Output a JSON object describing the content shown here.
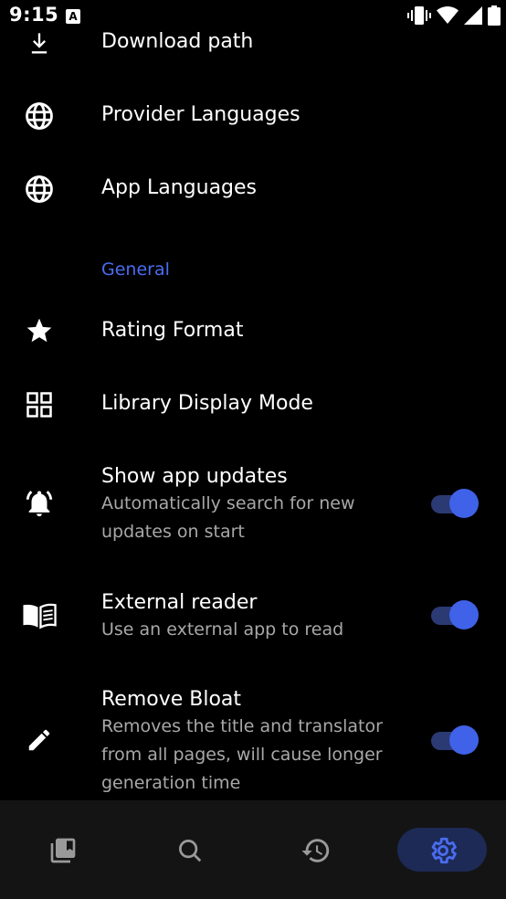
{
  "status_bar": {
    "time": "9:15",
    "notification_letter": "A",
    "icons": [
      "vibrate-icon",
      "wifi-icon",
      "signal-icon",
      "battery-icon"
    ]
  },
  "settings": {
    "download_path": {
      "label": "Download path",
      "icon": "download-icon"
    },
    "provider_languages": {
      "label": "Provider Languages",
      "icon": "globe-icon"
    },
    "app_languages": {
      "label": "App Languages",
      "icon": "globe-icon"
    },
    "general_header": "General",
    "rating_format": {
      "label": "Rating Format",
      "icon": "star-icon"
    },
    "library_display_mode": {
      "label": "Library Display Mode",
      "icon": "grid-icon"
    },
    "show_app_updates": {
      "label": "Show app updates",
      "summary": "Automatically search for new updates on start",
      "enabled": true,
      "icon": "bell-ringing-icon"
    },
    "external_reader": {
      "label": "External reader",
      "summary": "Use an external app to read",
      "enabled": true,
      "icon": "book-icon"
    },
    "remove_bloat": {
      "label": "Remove Bloat",
      "summary": "Removes the title and translator from all pages, will cause longer generation time",
      "enabled": true,
      "icon": "pencil-icon"
    }
  },
  "bottom_nav": {
    "items": [
      {
        "name": "library",
        "icon": "library-icon",
        "active": false
      },
      {
        "name": "search",
        "icon": "search-icon",
        "active": false
      },
      {
        "name": "history",
        "icon": "history-icon",
        "active": false
      },
      {
        "name": "settings",
        "icon": "gear-icon",
        "active": true
      }
    ]
  },
  "colors": {
    "accent": "#4a6cf0",
    "switch_thumb": "#3f62e8",
    "switch_track": "#2b3a73",
    "nav_background": "#141414",
    "active_pill": "#1c2a55"
  }
}
